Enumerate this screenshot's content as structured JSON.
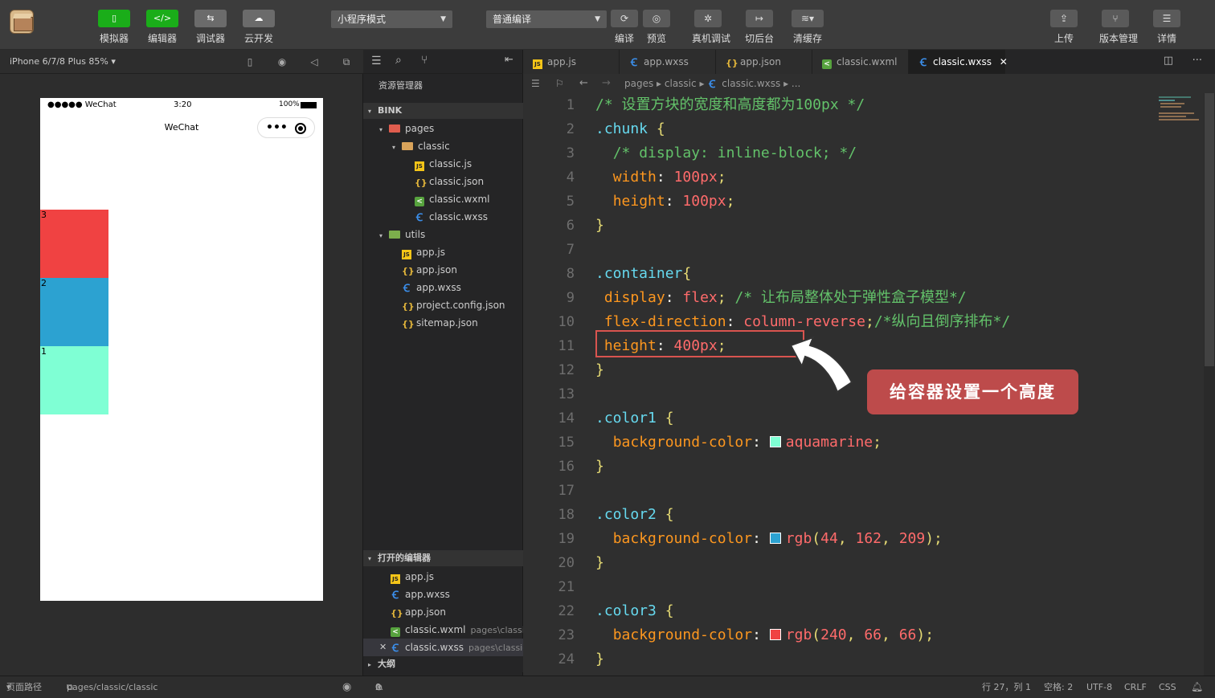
{
  "toolbar": {
    "modes": [
      {
        "label": "模拟器",
        "icon": "phone-icon"
      },
      {
        "label": "编辑器",
        "icon": "code-icon"
      },
      {
        "label": "调试器",
        "icon": "debug-icon"
      },
      {
        "label": "云开发",
        "icon": "cloud-icon"
      }
    ],
    "mode_select": "小程序模式",
    "compile_select": "普通编译",
    "actions": [
      {
        "label": "编译",
        "icon": "refresh-icon"
      },
      {
        "label": "预览",
        "icon": "eye-icon"
      },
      {
        "label": "真机调试",
        "icon": "bug-icon"
      },
      {
        "label": "切后台",
        "icon": "switch-icon"
      },
      {
        "label": "清缓存",
        "icon": "layers-icon"
      }
    ],
    "right_actions": [
      {
        "label": "上传",
        "icon": "upload-icon"
      },
      {
        "label": "版本管理",
        "icon": "branch-icon"
      },
      {
        "label": "详情",
        "icon": "menu-icon"
      }
    ]
  },
  "simulator": {
    "device": "iPhone 6/7/8 Plus 85%",
    "status_carrier": "●●●●● WeChat",
    "status_time": "3:20",
    "status_battery": "100%",
    "nav_title": "WeChat",
    "blocks": [
      {
        "label": "3",
        "color": "#f04242"
      },
      {
        "label": "2",
        "color": "#2ca2d1"
      },
      {
        "label": "1",
        "color": "#7fffd4"
      }
    ]
  },
  "explorer": {
    "title": "资源管理器",
    "project": "BINK",
    "tree": [
      {
        "label": "pages",
        "type": "folder-red",
        "depth": 1,
        "arrow": "▾"
      },
      {
        "label": "classic",
        "type": "folder",
        "depth": 2,
        "arrow": "▾"
      },
      {
        "label": "classic.js",
        "type": "js",
        "depth": 3
      },
      {
        "label": "classic.json",
        "type": "json",
        "depth": 3
      },
      {
        "label": "classic.wxml",
        "type": "wxml",
        "depth": 3
      },
      {
        "label": "classic.wxss",
        "type": "wxss",
        "depth": 3
      },
      {
        "label": "utils",
        "type": "folder-green",
        "depth": 1,
        "arrow": "▾"
      },
      {
        "label": "app.js",
        "type": "js",
        "depth": 2
      },
      {
        "label": "app.json",
        "type": "json",
        "depth": 2
      },
      {
        "label": "app.wxss",
        "type": "wxss",
        "depth": 2
      },
      {
        "label": "project.config.json",
        "type": "json",
        "depth": 2
      },
      {
        "label": "sitemap.json",
        "type": "json",
        "depth": 2
      }
    ],
    "open_editors_title": "打开的编辑器",
    "open_editors": [
      {
        "label": "app.js",
        "type": "js",
        "path": ""
      },
      {
        "label": "app.wxss",
        "type": "wxss",
        "path": ""
      },
      {
        "label": "app.json",
        "type": "json",
        "path": ""
      },
      {
        "label": "classic.wxml",
        "type": "wxml",
        "path": "pages\\classic"
      },
      {
        "label": "classic.wxss",
        "type": "wxss",
        "path": "pages\\classic"
      }
    ],
    "outline_title": "大纲"
  },
  "editor": {
    "tabs": [
      {
        "label": "app.js",
        "type": "js"
      },
      {
        "label": "app.wxss",
        "type": "wxss"
      },
      {
        "label": "app.json",
        "type": "json"
      },
      {
        "label": "classic.wxml",
        "type": "wxml"
      },
      {
        "label": "classic.wxss",
        "type": "wxss",
        "active": true
      }
    ],
    "breadcrumb": [
      "pages",
      "classic",
      "classic.wxss",
      "..."
    ],
    "lines": [
      [
        [
          "cm",
          "/* 设置方块的宽度和高度都为100px */"
        ]
      ],
      [
        [
          "sel",
          ".chunk "
        ],
        [
          "brace",
          "{"
        ]
      ],
      [
        [
          "",
          "  "
        ],
        [
          "cm",
          "/* display: inline-block; */"
        ]
      ],
      [
        [
          "",
          "  "
        ],
        [
          "prop",
          "width"
        ],
        [
          "",
          ": "
        ],
        [
          "num",
          "100px"
        ],
        [
          "val",
          ";"
        ]
      ],
      [
        [
          "",
          "  "
        ],
        [
          "prop",
          "height"
        ],
        [
          "",
          ": "
        ],
        [
          "num",
          "100px"
        ],
        [
          "val",
          ";"
        ]
      ],
      [
        [
          "brace",
          "}"
        ]
      ],
      [],
      [
        [
          "sel",
          ".container"
        ],
        [
          "brace",
          "{"
        ]
      ],
      [
        [
          "prop",
          " display"
        ],
        [
          "",
          ": "
        ],
        [
          "kw",
          "flex"
        ],
        [
          "val",
          "; "
        ],
        [
          "cm",
          "/* 让布局整体处于弹性盒子模型*/"
        ]
      ],
      [
        [
          "prop",
          " flex-direction"
        ],
        [
          "",
          ": "
        ],
        [
          "kw",
          "column-reverse"
        ],
        [
          "val",
          ";"
        ],
        [
          "cm",
          "/*纵向且倒序排布*/"
        ]
      ],
      [
        [
          "prop",
          " height"
        ],
        [
          "",
          ": "
        ],
        [
          "num",
          "400px"
        ],
        [
          "val",
          ";"
        ]
      ],
      [
        [
          "brace",
          "}"
        ]
      ],
      [],
      [
        [
          "sel",
          ".color1 "
        ],
        [
          "brace",
          "{"
        ]
      ],
      [
        [
          "",
          "  "
        ],
        [
          "prop",
          "background-color"
        ],
        [
          "",
          ": "
        ],
        [
          "sw",
          "#7fffd4"
        ],
        [
          "kw",
          "aquamarine"
        ],
        [
          "val",
          ";"
        ]
      ],
      [
        [
          "brace",
          "}"
        ]
      ],
      [],
      [
        [
          "sel",
          ".color2 "
        ],
        [
          "brace",
          "{"
        ]
      ],
      [
        [
          "",
          "  "
        ],
        [
          "prop",
          "background-color"
        ],
        [
          "",
          ": "
        ],
        [
          "sw",
          "#2ca2d1"
        ],
        [
          "kw",
          "rgb"
        ],
        [
          "val",
          "("
        ],
        [
          "num",
          "44"
        ],
        [
          "val",
          ", "
        ],
        [
          "num",
          "162"
        ],
        [
          "val",
          ", "
        ],
        [
          "num",
          "209"
        ],
        [
          "val",
          ");"
        ]
      ],
      [
        [
          "brace",
          "}"
        ]
      ],
      [],
      [
        [
          "sel",
          ".color3 "
        ],
        [
          "brace",
          "{"
        ]
      ],
      [
        [
          "",
          "  "
        ],
        [
          "prop",
          "background-color"
        ],
        [
          "",
          ": "
        ],
        [
          "sw",
          "#f04242"
        ],
        [
          "kw",
          "rgb"
        ],
        [
          "val",
          "("
        ],
        [
          "num",
          "240"
        ],
        [
          "val",
          ", "
        ],
        [
          "num",
          "66"
        ],
        [
          "val",
          ", "
        ],
        [
          "num",
          "66"
        ],
        [
          "val",
          ");"
        ]
      ],
      [
        [
          "brace",
          "}"
        ]
      ]
    ],
    "callout": "给容器设置一个高度"
  },
  "statusbar": {
    "page_path_label": "页面路径",
    "page_path": "pages/classic/classic",
    "errors": "0",
    "warnings": "0",
    "cursor": "行 27，列 1",
    "indent": "空格: 2",
    "encoding": "UTF-8",
    "eol": "CRLF",
    "lang": "CSS"
  }
}
